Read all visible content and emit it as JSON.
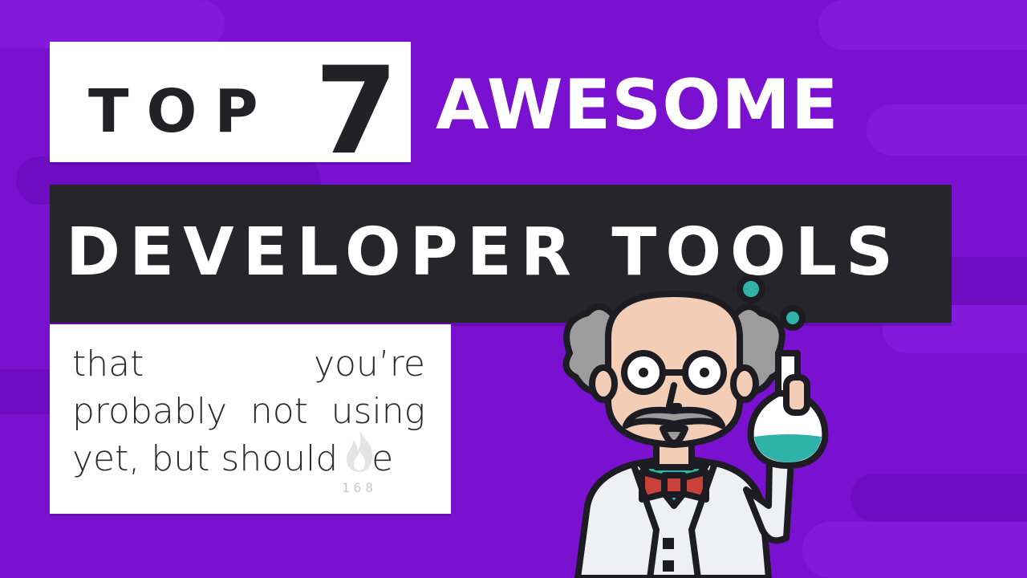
{
  "title": {
    "top_word": "TOP",
    "number": "7",
    "awesome": "AWESOME",
    "developer_tools": "DEVELOPER TOOLS"
  },
  "subtitle": {
    "line": "that you’re probably not using yet, but should be"
  },
  "badge": {
    "count": "168",
    "icon": "flame-icon"
  },
  "colors": {
    "background": "#7a10d0",
    "dark_bar": "#26252b",
    "text_dark": "#222126",
    "flask_liquid": "#2fb3a8"
  }
}
